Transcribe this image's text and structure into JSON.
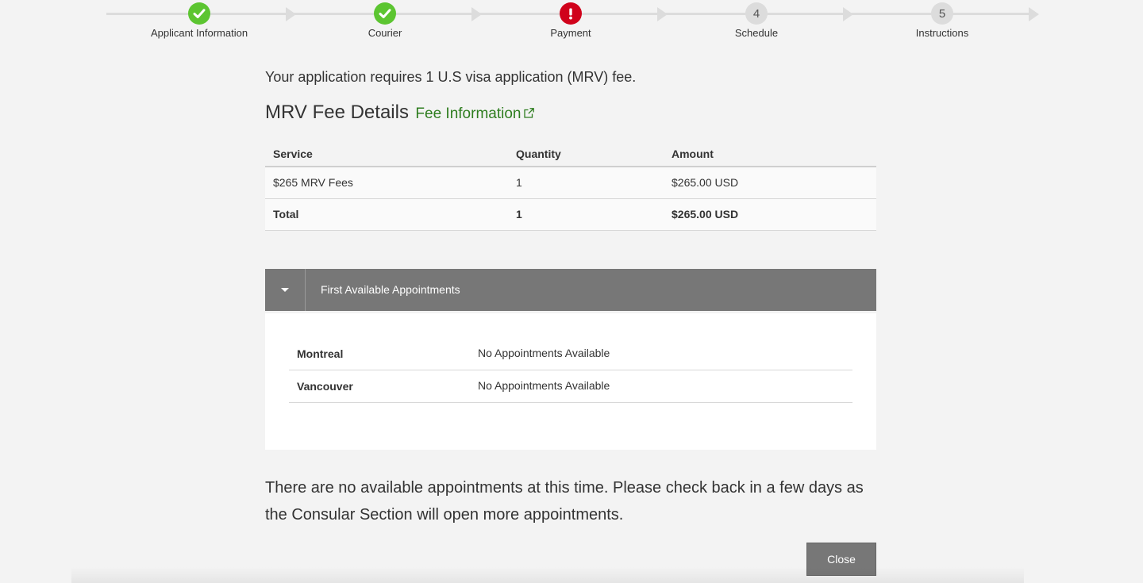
{
  "stepper": {
    "steps": [
      {
        "label": "Applicant Information",
        "state": "done",
        "icon": "check-icon"
      },
      {
        "label": "Courier",
        "state": "done",
        "icon": "check-icon"
      },
      {
        "label": "Payment",
        "state": "error",
        "icon": "exclamation-icon"
      },
      {
        "label": "Schedule",
        "state": "pending",
        "number": "4"
      },
      {
        "label": "Instructions",
        "state": "pending",
        "number": "5"
      }
    ]
  },
  "main": {
    "requirement_text": "Your application requires 1 U.S visa application (MRV) fee.",
    "fee_heading": "MRV Fee Details",
    "fee_link_label": "Fee Information",
    "fee_table": {
      "headers": [
        "Service",
        "Quantity",
        "Amount"
      ],
      "rows": [
        [
          "$265 MRV Fees",
          "1",
          "$265.00 USD"
        ]
      ],
      "total": [
        "Total",
        "1",
        "$265.00 USD"
      ]
    },
    "appointments": {
      "title": "First Available Appointments",
      "rows": [
        {
          "city": "Montreal",
          "status": "No Appointments Available"
        },
        {
          "city": "Vancouver",
          "status": "No Appointments Available"
        }
      ]
    },
    "notice": "There are no available appointments at this time. Please check back in a few days as the Consular Section will open more appointments.",
    "close_label": "Close"
  },
  "colors": {
    "done": "#5cc531",
    "error": "#d0021b",
    "link": "#2e7d1f",
    "accordion": "#777777"
  }
}
